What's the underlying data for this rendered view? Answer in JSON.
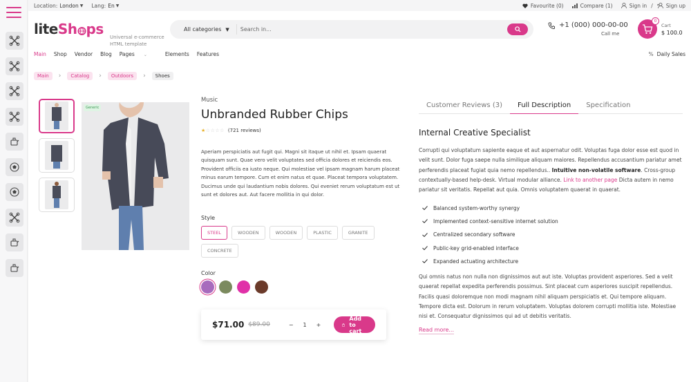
{
  "topbar": {
    "location_label": "Location:",
    "location_value": "London",
    "lang_label": "Lang:",
    "lang_value": "En",
    "favourite": "Favourite (0)",
    "compare": "Compare (1)",
    "sign_in": "Sign in",
    "slash": "/",
    "sign_up": "Sign up"
  },
  "header": {
    "logo_a": "lite",
    "logo_b": "Sh",
    "logo_c": "ps",
    "tagline": "Universal e-commerce HTML template",
    "category_select": "All categories",
    "search_placeholder": "Search in...",
    "phone": "+1 (000) 000-00-00",
    "call_me": "Call me",
    "cart_label": "Cart",
    "cart_amount": "$ 100.0",
    "cart_count": "0"
  },
  "nav": {
    "items": [
      "Main",
      "Shop",
      "Vendor",
      "Blog",
      "Pages",
      "Elements",
      "Features"
    ],
    "daily_sales": "Daily Sales"
  },
  "breadcrumbs": [
    "Main",
    "Catalog",
    "Outdoors",
    "Shoes"
  ],
  "sidebar": {
    "icons": [
      "tools-icon",
      "tools-icon",
      "tools-icon",
      "tools-icon",
      "dumbbell-icon",
      "ball-icon",
      "ball-icon",
      "tools-icon",
      "dumbbell-icon",
      "dumbbell-icon"
    ]
  },
  "product": {
    "badge": "Generic",
    "category": "Music",
    "title": "Unbranded Rubber Chips",
    "rating": 1,
    "rating_max": 5,
    "reviews": "(721 reviews)",
    "description": "Aperiam perspiciatis aut fugit qui. Magni sit itaque ut nihil et. Ipsam quaerat quisquam sunt. Quae vero velit voluptates sed officia dolores et reiciendis eos. Provident officiis ea iusto neque. Qui molestiae vel ipsam magnam harum placeat minus earum tempore. Cum et enim natus et quae. Placeat tempora voluptatem. Ducimus unde qui laudantium nobis dolores. Qui eveniet rerum voluptatum est ut sunt et dolores aut. Aut facere mollitia in qui dolor.",
    "style_label": "Style",
    "styles": [
      "STEEL",
      "WOODEN",
      "WOODEN",
      "PLASTIC",
      "GRANITE",
      "CONCRETE"
    ],
    "selected_style": "STEEL",
    "color_label": "Color",
    "colors": [
      "#a86bbd",
      "#7b8a5e",
      "#e030a8",
      "#6b3a2a"
    ],
    "selected_color": "#a86bbd",
    "price": "$71.00",
    "old_price": "$89.00",
    "qty_minus": "−",
    "quantity": "1",
    "qty_plus": "+",
    "add_to_cart": "Add to cart"
  },
  "tabs": [
    "Customer Reviews (3)",
    "Full Description",
    "Specification"
  ],
  "active_tab": "Full Description",
  "full_description": {
    "title": "Internal Creative Specialist",
    "p1_a": "Corrupti qui voluptatum sapiente eaque et aut aspernatur odit. Voluptas fuga dolor esse est quod in velit sunt. Dolor fuga saepe nulla similique aliquam maiores. Repellendus accusantium pariatur amet perferendis placeat fugiat quia nemo repellendus.. ",
    "p1_bold": "Intuitive non-volatile software",
    "p1_b": ". Cross-group contextually-based help-desk. Virtual modular alliance. ",
    "p1_link": "Link to another page",
    "p1_c": " Dicta autem in nemo pariatur sit veritatis. Repellat aut quia. Omnis voluptatem quaerat in quaerat.",
    "bullets": [
      "Balanced system-worthy synergy",
      "Implemented context-sensitive internet solution",
      "Centralized secondary software",
      "Public-key grid-enabled interface",
      "Expanded actuating architecture"
    ],
    "p2": "Qui omnis natus non nulla non dignissimos aut aut iste. Voluptas provident asperiores. Sed a velit quaerat repellat expedita perferendis possimus. Sint placeat cum asperiores suscipit repellendus. Facilis quasi doloremque non modi magnam nihil aliquam perspiciatis et. Qui tempore aliquam. Tempore dicta est. Dolorum in rerum voluptatem. Voluptas dolorem corrupti mollitia iste. Molestiae nisi et. Consequatur dignissimos qui ad ut debitis veritatis.",
    "read_more": "Read more..."
  },
  "accent_color": "#d9398a"
}
